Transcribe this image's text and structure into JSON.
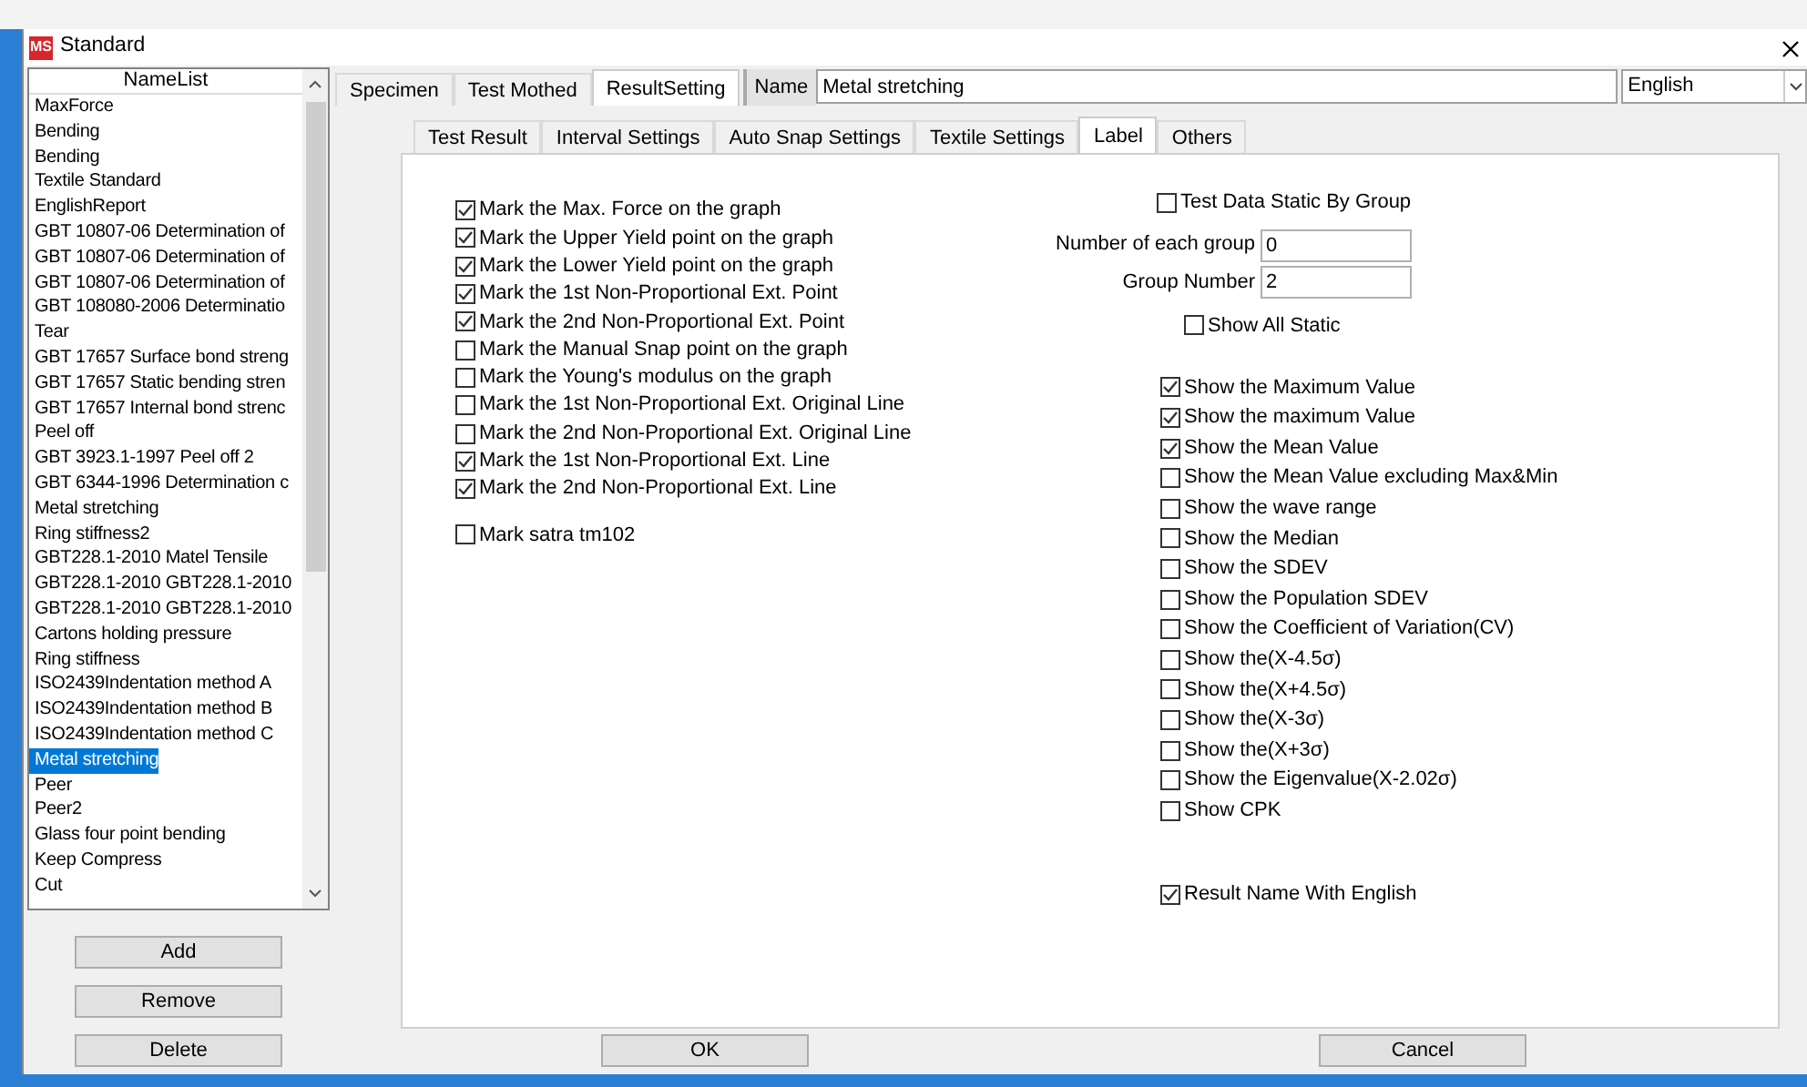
{
  "window": {
    "icon_text": "MS",
    "title": "Standard"
  },
  "name_list": {
    "header": "NameList",
    "items": [
      {
        "label": "MaxForce",
        "selected": false
      },
      {
        "label": "Bending",
        "selected": false
      },
      {
        "label": "Bending",
        "selected": false
      },
      {
        "label": "Textile Standard",
        "selected": false
      },
      {
        "label": "EnglishReport",
        "selected": false
      },
      {
        "label": "GBT 10807-06 Determination of",
        "selected": false
      },
      {
        "label": "GBT 10807-06 Determination of",
        "selected": false
      },
      {
        "label": "GBT 10807-06 Determination of",
        "selected": false
      },
      {
        "label": "GBT 108080-2006 Determinatio",
        "selected": false
      },
      {
        "label": "Tear",
        "selected": false
      },
      {
        "label": "GBT 17657 Surface bond streng",
        "selected": false
      },
      {
        "label": "GBT 17657 Static bending stren",
        "selected": false
      },
      {
        "label": "GBT 17657 Internal bond strenc",
        "selected": false
      },
      {
        "label": "Peel off",
        "selected": false
      },
      {
        "label": "GBT 3923.1-1997 Peel off 2",
        "selected": false
      },
      {
        "label": "GBT 6344-1996 Determination c",
        "selected": false
      },
      {
        "label": "Metal stretching",
        "selected": false
      },
      {
        "label": "Ring stiffness2",
        "selected": false
      },
      {
        "label": "GBT228.1-2010 Matel Tensile",
        "selected": false
      },
      {
        "label": "GBT228.1-2010 GBT228.1-2010",
        "selected": false
      },
      {
        "label": "GBT228.1-2010 GBT228.1-2010",
        "selected": false
      },
      {
        "label": "Cartons holding pressure",
        "selected": false
      },
      {
        "label": "Ring stiffness",
        "selected": false
      },
      {
        "label": "ISO2439Indentation method A",
        "selected": false
      },
      {
        "label": "ISO2439Indentation method B",
        "selected": false
      },
      {
        "label": "ISO2439Indentation method C",
        "selected": false
      },
      {
        "label": "Metal stretching",
        "selected": true
      },
      {
        "label": "Peer",
        "selected": false
      },
      {
        "label": "Peer2",
        "selected": false
      },
      {
        "label": "Glass four point bending",
        "selected": false
      },
      {
        "label": "Keep Compress",
        "selected": false
      },
      {
        "label": "Cut",
        "selected": false
      }
    ]
  },
  "list_buttons": [
    "Add",
    "Remove",
    "Delete"
  ],
  "tabs": [
    {
      "label": "Specimen",
      "selected": false
    },
    {
      "label": "Test Mothed",
      "selected": false
    },
    {
      "label": "ResultSetting",
      "selected": true
    }
  ],
  "name_field": {
    "label": "Name",
    "value": "Metal stretching"
  },
  "language": {
    "value": "English"
  },
  "subtabs": [
    {
      "label": "Test Result",
      "selected": false
    },
    {
      "label": "Interval Settings",
      "selected": false
    },
    {
      "label": "Auto Snap Settings",
      "selected": false
    },
    {
      "label": "Textile Settings",
      "selected": false
    },
    {
      "label": "Label",
      "selected": true
    },
    {
      "label": "Others",
      "selected": false
    }
  ],
  "mark_options": [
    {
      "label": "Mark the Max. Force on the graph",
      "checked": true
    },
    {
      "label": "Mark the Upper Yield point on the graph",
      "checked": true
    },
    {
      "label": "Mark the Lower Yield point on the graph",
      "checked": true
    },
    {
      "label": "Mark the 1st Non-Proportional Ext. Point",
      "checked": true
    },
    {
      "label": "Mark the 2nd Non-Proportional Ext. Point",
      "checked": true
    },
    {
      "label": "Mark the Manual Snap point on the graph",
      "checked": false
    },
    {
      "label": "Mark the Young's modulus on the graph",
      "checked": false
    },
    {
      "label": "Mark the 1st Non-Proportional Ext. Original Line",
      "checked": false
    },
    {
      "label": "Mark the 2nd Non-Proportional Ext. Original Line",
      "checked": false
    },
    {
      "label": "Mark the 1st Non-Proportional Ext. Line",
      "checked": true
    },
    {
      "label": "Mark the 2nd Non-Proportional Ext. Line",
      "checked": true
    }
  ],
  "mark_satra": {
    "label": "Mark satra tm102",
    "checked": false
  },
  "group_static": {
    "label": "Test Data Static By Group",
    "checked": false
  },
  "group_fields": [
    {
      "label": "Number of each group",
      "value": "0"
    },
    {
      "label": "Group Number",
      "value": "2"
    }
  ],
  "show_all_static": {
    "label": "Show All Static",
    "checked": false
  },
  "show_options": [
    {
      "label": "Show the Maximum Value",
      "checked": true
    },
    {
      "label": "Show the maximum Value",
      "checked": true
    },
    {
      "label": "Show the Mean Value",
      "checked": true
    },
    {
      "label": "Show the Mean Value excluding Max&Min",
      "checked": false
    },
    {
      "label": "Show the wave range",
      "checked": false
    },
    {
      "label": "Show the Median",
      "checked": false
    },
    {
      "label": "Show the SDEV",
      "checked": false
    },
    {
      "label": "Show the Population SDEV",
      "checked": false
    },
    {
      "label": "Show the Coefficient of Variation(CV)",
      "checked": false
    },
    {
      "label": "Show the(X-4.5σ)",
      "checked": false
    },
    {
      "label": "Show the(X+4.5σ)",
      "checked": false
    },
    {
      "label": "Show the(X-3σ)",
      "checked": false
    },
    {
      "label": "Show the(X+3σ)",
      "checked": false
    },
    {
      "label": "Show the Eigenvalue(X-2.02σ)",
      "checked": false
    },
    {
      "label": "Show CPK",
      "checked": false
    }
  ],
  "result_name_english": {
    "label": "Result Name With English",
    "checked": true
  },
  "buttons": [
    "OK",
    "Cancel"
  ]
}
